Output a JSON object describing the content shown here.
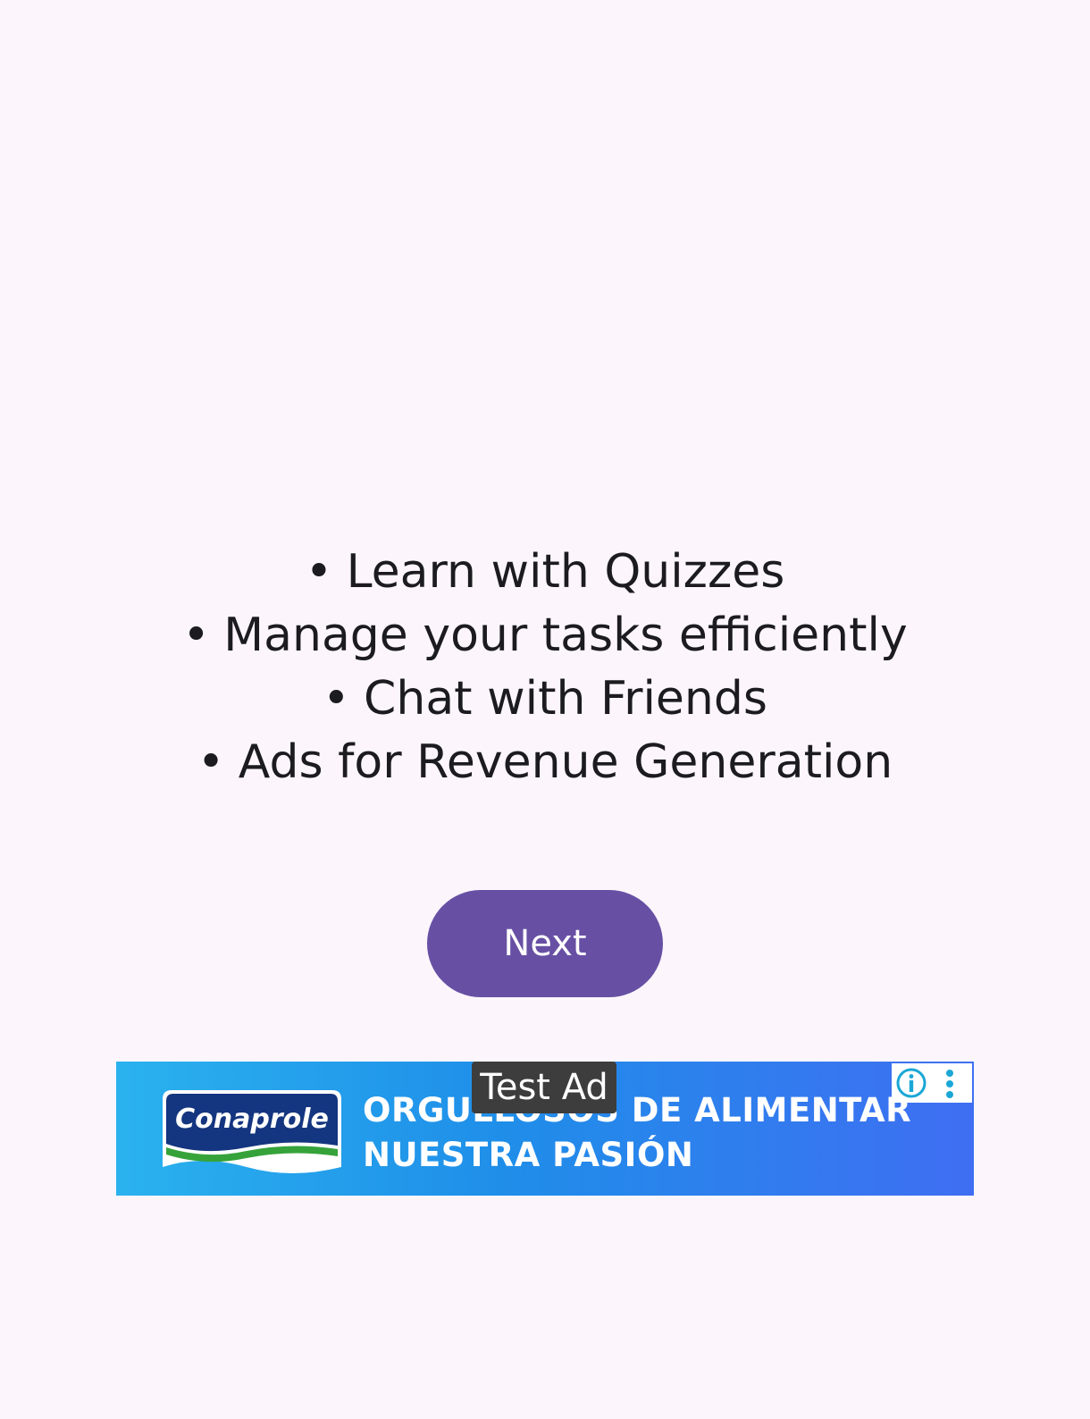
{
  "features": {
    "bullet": "•",
    "items": [
      "Learn with Quizzes",
      "Manage your tasks efficiently",
      "Chat with Friends",
      "Ads for Revenue Generation"
    ]
  },
  "next_button": {
    "label": "Next"
  },
  "ad": {
    "test_label": "Test Ad",
    "brand": "Conaprole",
    "headline_line1": "ORGULLOSOS DE ALIMENTAR",
    "headline_line2": "NUESTRA PASIÓN",
    "info_icon": "info-icon",
    "menu_icon": "more-vert-icon"
  },
  "colors": {
    "background": "#fcf6fc",
    "primary": "#6750a4",
    "text": "#1c1b1f",
    "ad_accent": "#1aa7d6"
  }
}
